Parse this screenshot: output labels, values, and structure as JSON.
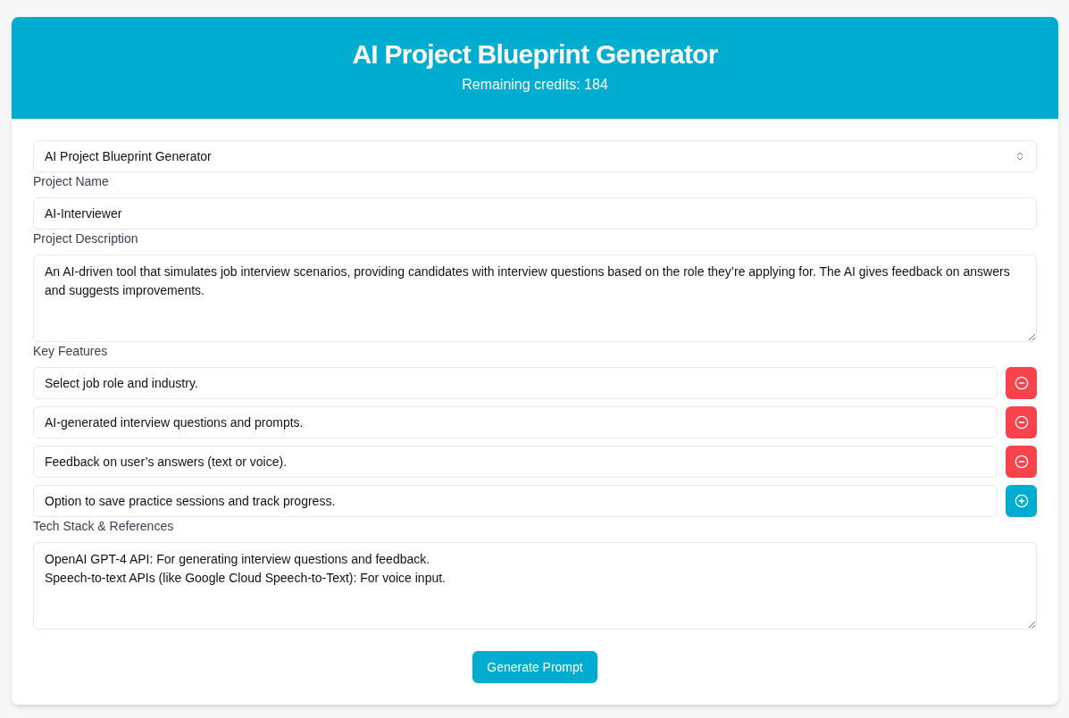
{
  "header": {
    "title": "AI Project Blueprint Generator",
    "credits": "Remaining credits: 184"
  },
  "template_select": {
    "value": "AI Project Blueprint Generator"
  },
  "project_name": {
    "label": "Project Name",
    "value": "AI-Interviewer"
  },
  "project_description": {
    "label": "Project Description",
    "value": "An AI-driven tool that simulates job interview scenarios, providing candidates with interview questions based on the role they’re applying for. The AI gives feedback on answers and suggests improvements."
  },
  "key_features": {
    "label": "Key Features",
    "items": [
      {
        "value": "Select job role and industry.",
        "kind": "remove"
      },
      {
        "value": "AI-generated interview questions and prompts.",
        "kind": "remove"
      },
      {
        "value": "Feedback on user’s answers (text or voice).",
        "kind": "remove"
      },
      {
        "value": "Option to save practice sessions and track progress.",
        "kind": "add"
      }
    ]
  },
  "tech_stack": {
    "label": "Tech Stack & References",
    "value": "OpenAI GPT-4 API: For generating interview questions and feedback.\nSpeech-to-text APIs (like Google Cloud Speech-to-Text): For voice input."
  },
  "generate_button": "Generate Prompt"
}
